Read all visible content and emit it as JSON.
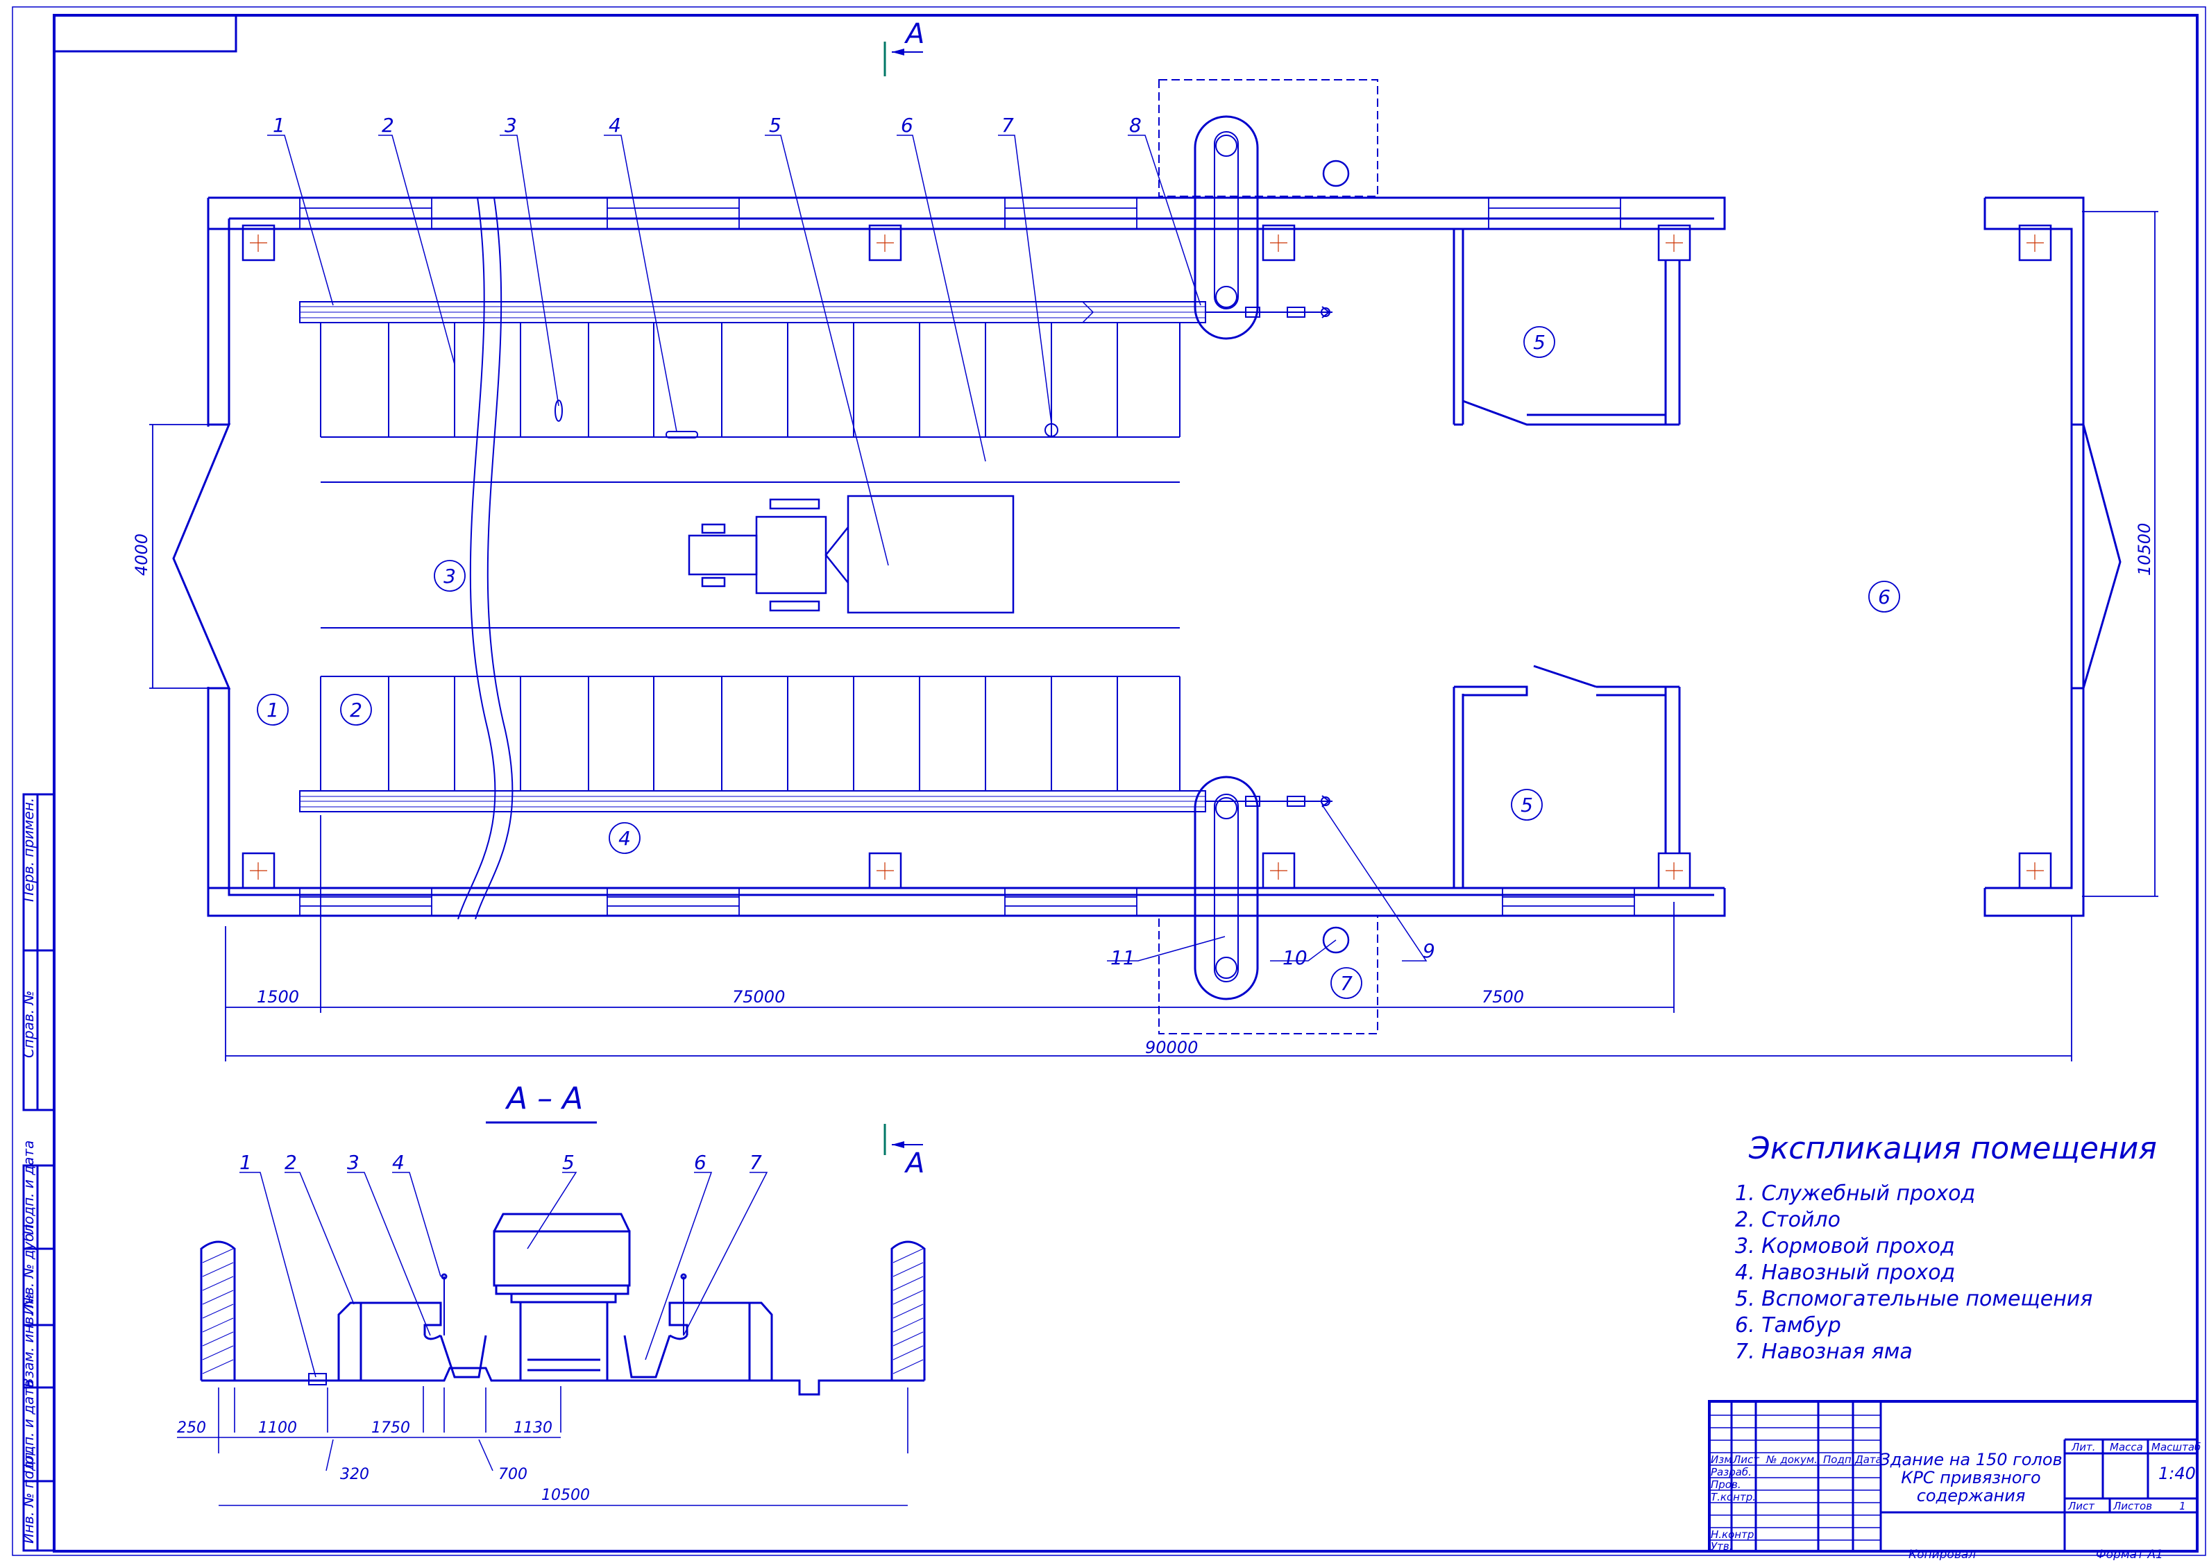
{
  "colors": {
    "line": "#0000cc",
    "accent": "#cc3300",
    "frame": "#0000cc",
    "section_mark": "#007766"
  },
  "section_marks": {
    "top": "А",
    "bottom": "А"
  },
  "plan": {
    "callouts": [
      "1",
      "2",
      "3",
      "4",
      "5",
      "6",
      "7",
      "8",
      "9",
      "10",
      "11"
    ],
    "zones": [
      "1",
      "2",
      "3",
      "4",
      "5",
      "5",
      "6",
      "7"
    ],
    "dimensions": {
      "left_height": "4000",
      "right_height": "10500",
      "seg_a": "1500",
      "seg_b": "75000",
      "seg_c": "7500",
      "total": "90000"
    }
  },
  "section": {
    "title": "А – А",
    "callouts": [
      "1",
      "2",
      "3",
      "4",
      "5",
      "6",
      "7"
    ],
    "dimensions": {
      "d250": "250",
      "d1100": "1100",
      "d1750": "1750",
      "d1130": "1130",
      "d320": "320",
      "d700": "700",
      "d10500": "10500"
    }
  },
  "explication": {
    "title": "Экспликация помещения",
    "items": [
      "1. Служебный проход",
      "2. Стойло",
      "3. Кормовой проход",
      "4. Навозный проход",
      "5. Вспомогательные помещения",
      "6. Тамбур",
      "7. Навозная яма"
    ]
  },
  "title_block": {
    "name_line1": "Здание на 150 голов",
    "name_line2": "КРС привязного",
    "name_line3": "содержания",
    "col_izm": "Изм",
    "col_list": "Лист",
    "col_doc": "№ докум.",
    "col_sign": "Подп.",
    "col_date": "Дата",
    "row_razrab": "Разраб.",
    "row_prov": "Пров.",
    "row_tkontr": "Т.контр.",
    "row_nkontr": "Н.контр.",
    "row_utv": "Утв.",
    "lit": "Лит.",
    "massa": "Масса",
    "masshtab": "Масштаб",
    "scale_value": "1:40",
    "list_label": "Лист",
    "listov_label": "Листов",
    "listov_value": "1",
    "copied": "Копировал",
    "format": "Формат   А1"
  },
  "side_stamp": {
    "perv_primen": "Перв. примен.",
    "sprav": "Справ. №",
    "podp_data_1": "Подп. и дата",
    "inv_dubl": "Инв. № дубл.",
    "vzam_inv": "Взам. инв. №",
    "podp_data_2": "Подп. и дата",
    "inv_podl": "Инв. № подл."
  }
}
